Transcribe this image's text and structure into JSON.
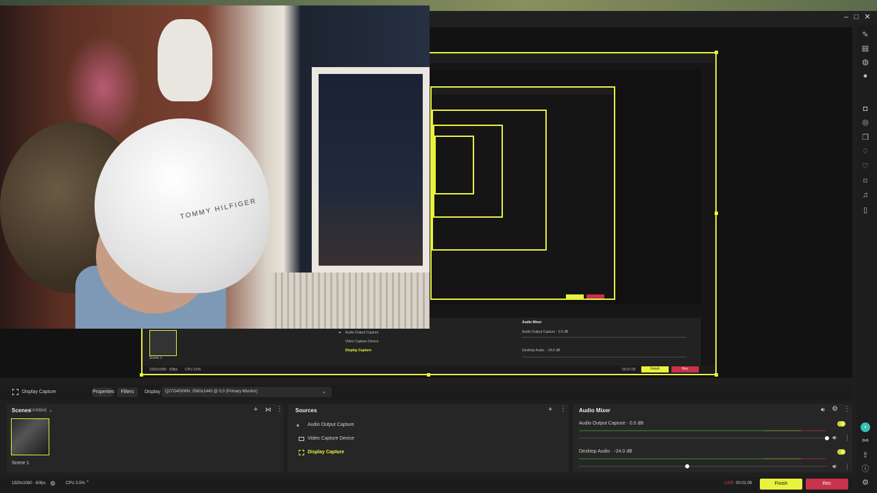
{
  "window": {
    "minimize_glyph": "–",
    "maximize_glyph": "□",
    "close_glyph": "✕"
  },
  "context_bar": {
    "source_name": "Display Capture",
    "properties_label": "Properties",
    "filters_label": "Filters",
    "display_label": "Display",
    "display_value": "Q27G40XMN: 2560x1440 @ 0,0 (Primary Monitor)"
  },
  "scenes": {
    "title": "Scenes",
    "collection": "Untitled",
    "items": [
      {
        "label": "Scene 1"
      }
    ]
  },
  "sources": {
    "title": "Sources",
    "items": [
      {
        "label": "Audio Output Capture",
        "icon": "speaker-icon"
      },
      {
        "label": "Video Capture Device",
        "icon": "camera-icon"
      },
      {
        "label": "Display Capture",
        "icon": "display-icon",
        "selected": true
      }
    ]
  },
  "audio_mixer": {
    "title": "Audio Mixer",
    "channels": [
      {
        "label": "Audio Output Capture · 0.0 dB",
        "enabled": true,
        "volume": 0.95
      },
      {
        "label": "Desktop Audio · -24.0 dB",
        "enabled": true,
        "volume": 0.4
      }
    ]
  },
  "status": {
    "resolution": "1920x1080 · 60fps",
    "cpu": "CPU 3.5%",
    "live_label": "LIVE",
    "timer": "00:01:09",
    "finish_label": "Finish",
    "rec_label": "Rec"
  },
  "nested": {
    "scene_label": "Scene 1",
    "resolution": "1920x1080 · 60fps",
    "cpu": "CPU 3.6%",
    "source_items": [
      "Audio Output Capture",
      "Video Capture Device",
      "Display Capture"
    ],
    "mixer_title": "Audio Mixer",
    "mixer_items": [
      "Audio Output Capture · 0.0 dB",
      "Desktop Audio · -24.0 dB"
    ],
    "timer": "00:01:09",
    "finish_label": "Finish",
    "rec_label": "Rec"
  },
  "webcam": {
    "cap_text": "TOMMY HILFIGER"
  },
  "colors": {
    "accent": "#e9f23d",
    "rec": "#c8324a",
    "live": "#e04a4a"
  }
}
